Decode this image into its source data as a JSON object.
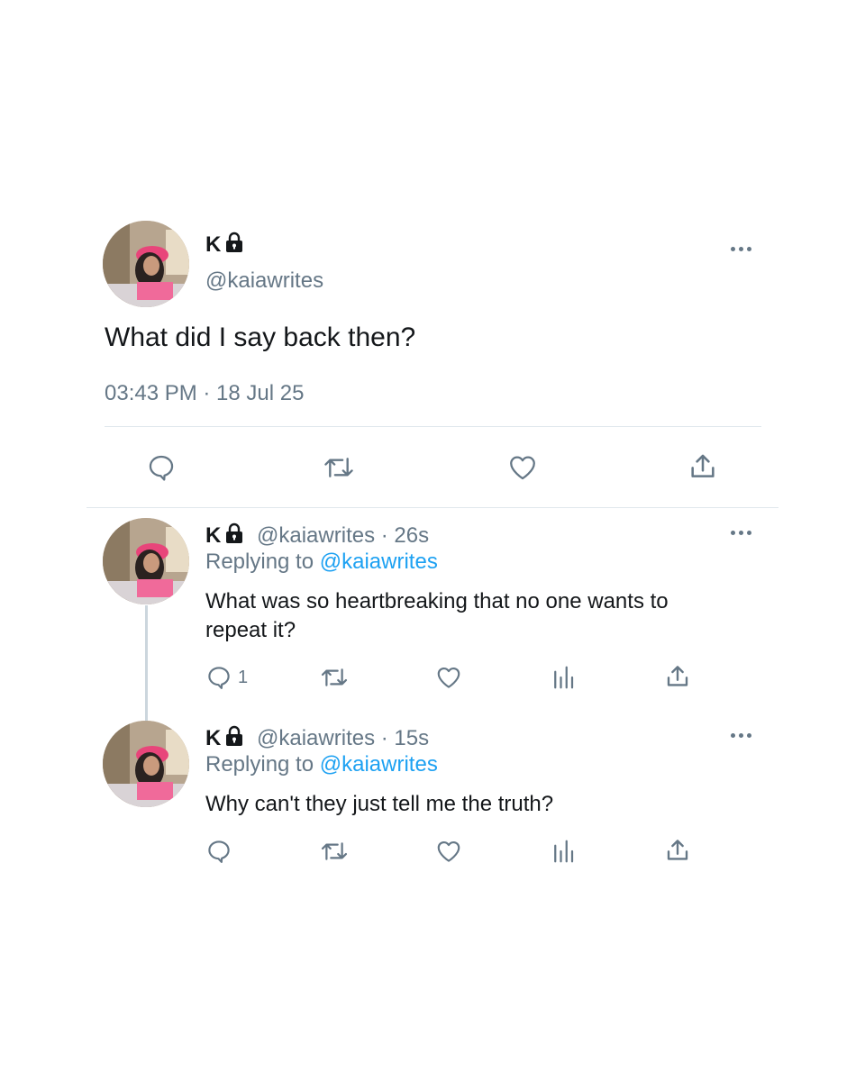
{
  "colors": {
    "text": "#14171a",
    "secondary": "#657786",
    "link": "#1da1f2",
    "divider": "#e1e8ed"
  },
  "main_tweet": {
    "display_name": "K",
    "handle": "@kaiawrites",
    "text": "What did I say back then?",
    "timestamp": "03:43 PM · 18 Jul 25",
    "icons": [
      "lock-icon",
      "more-icon",
      "reply-icon",
      "retweet-icon",
      "like-icon",
      "share-icon"
    ]
  },
  "replies": [
    {
      "display_name": "K",
      "handle_time": "@kaiawrites · 26s",
      "replying_prefix": "Replying to",
      "replying_to": "@kaiawrites",
      "text_line1": "What was so heartbreaking that no one wants to",
      "text_line2": "repeat it?",
      "reply_count": "1"
    },
    {
      "display_name": "K",
      "handle_time": "@kaiawrites · 15s",
      "replying_prefix": "Replying to",
      "replying_to": "@kaiawrites",
      "text_line1": "Why can't they just tell me the truth?",
      "reply_count": ""
    }
  ]
}
